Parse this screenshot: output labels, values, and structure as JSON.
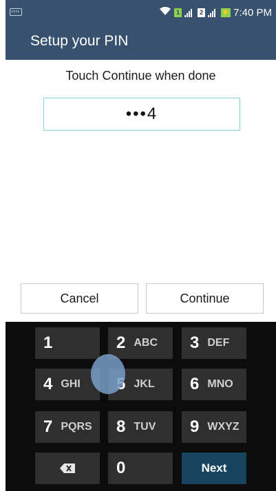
{
  "status_bar": {
    "sim1_label": "1",
    "sim2_label": "2",
    "battery_label": "⚡",
    "time": "7:40 PM"
  },
  "header": {
    "title": "Setup your PIN"
  },
  "instructions": "Touch Continue when done",
  "pin_field": {
    "value": "•••4"
  },
  "buttons": {
    "cancel": "Cancel",
    "continue": "Continue"
  },
  "keypad": {
    "rows": [
      [
        {
          "num": "1",
          "letters": ""
        },
        {
          "num": "2",
          "letters": "ABC"
        },
        {
          "num": "3",
          "letters": "DEF"
        }
      ],
      [
        {
          "num": "4",
          "letters": "GHI"
        },
        {
          "num": "5",
          "letters": "JKL"
        },
        {
          "num": "6",
          "letters": "MNO"
        }
      ],
      [
        {
          "num": "7",
          "letters": "PQRS"
        },
        {
          "num": "8",
          "letters": "TUV"
        },
        {
          "num": "9",
          "letters": "WXYZ"
        }
      ]
    ],
    "zero": "0",
    "next": "Next",
    "delete_icon": "backspace-icon"
  },
  "colors": {
    "header_bg": "#37516f",
    "pin_border": "#7fd1e6",
    "keyboard_bg": "#0c0c0c",
    "key_bg": "#2f2f2f",
    "next_key_bg": "#17445f"
  }
}
